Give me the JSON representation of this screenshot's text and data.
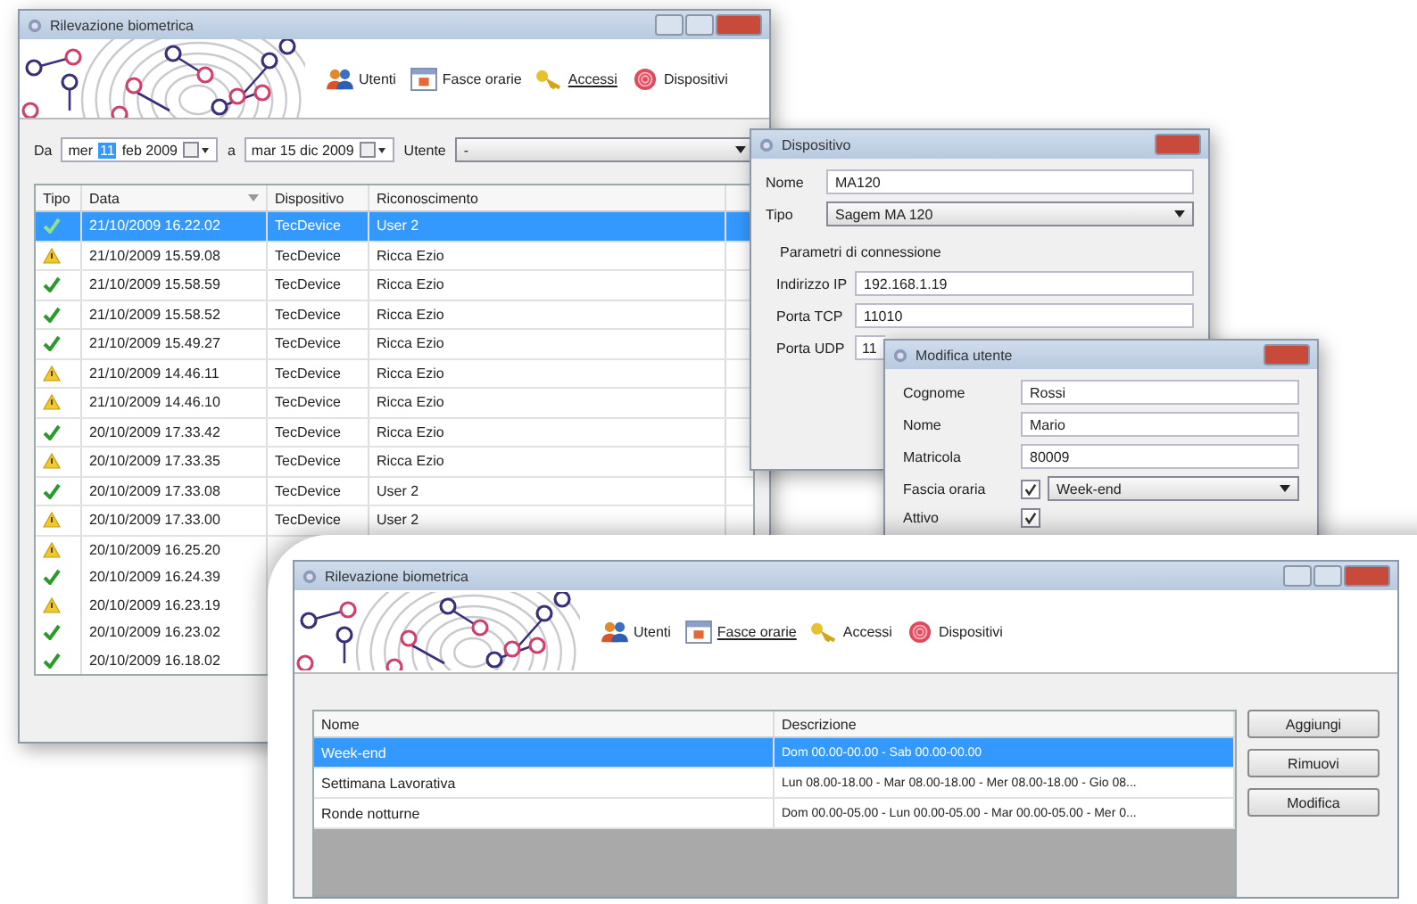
{
  "back_window": {
    "title": "Rilevazione biometrica",
    "toolbar": [
      {
        "label": "Utenti",
        "selected": false
      },
      {
        "label": "Fasce orarie",
        "selected": false
      },
      {
        "label": "Accessi",
        "selected": true
      },
      {
        "label": "Dispositivi",
        "selected": false
      }
    ],
    "filter": {
      "from_label": "Da",
      "from_weekday": "mer",
      "from_day": "11",
      "from_rest": "feb 2009",
      "to_label": "a",
      "to_date": "mar 15 dic 2009",
      "user_label": "Utente",
      "user_value": "-"
    },
    "table": {
      "columns": [
        "Tipo",
        "Data",
        "Dispositivo",
        "Riconoscimento"
      ],
      "rows": [
        {
          "kind": "ok",
          "date": "21/10/2009 16.22.02",
          "device": "TecDevice",
          "recognition": "User 2",
          "selected": true
        },
        {
          "kind": "warning",
          "date": "21/10/2009 15.59.08",
          "device": "TecDevice",
          "recognition": "Ricca Ezio",
          "selected": false
        },
        {
          "kind": "ok",
          "date": "21/10/2009 15.58.59",
          "device": "TecDevice",
          "recognition": "Ricca Ezio",
          "selected": false
        },
        {
          "kind": "ok",
          "date": "21/10/2009 15.58.52",
          "device": "TecDevice",
          "recognition": "Ricca Ezio",
          "selected": false
        },
        {
          "kind": "ok",
          "date": "21/10/2009 15.49.27",
          "device": "TecDevice",
          "recognition": "Ricca Ezio",
          "selected": false
        },
        {
          "kind": "warning",
          "date": "21/10/2009 14.46.11",
          "device": "TecDevice",
          "recognition": "Ricca Ezio",
          "selected": false
        },
        {
          "kind": "warning",
          "date": "21/10/2009 14.46.10",
          "device": "TecDevice",
          "recognition": "Ricca Ezio",
          "selected": false
        },
        {
          "kind": "ok",
          "date": "20/10/2009 17.33.42",
          "device": "TecDevice",
          "recognition": "Ricca Ezio",
          "selected": false
        },
        {
          "kind": "warning",
          "date": "20/10/2009 17.33.35",
          "device": "TecDevice",
          "recognition": "Ricca Ezio",
          "selected": false
        },
        {
          "kind": "ok",
          "date": "20/10/2009 17.33.08",
          "device": "TecDevice",
          "recognition": "User 2",
          "selected": false
        },
        {
          "kind": "warning",
          "date": "20/10/2009 17.33.00",
          "device": "TecDevice",
          "recognition": "User 2",
          "selected": false
        },
        {
          "kind": "warning",
          "date": "20/10/2009 16.25.20",
          "selected": false
        },
        {
          "kind": "ok",
          "date": "20/10/2009 16.24.39",
          "selected": false
        },
        {
          "kind": "warning",
          "date": "20/10/2009 16.23.19",
          "selected": false
        },
        {
          "kind": "ok",
          "date": "20/10/2009 16.23.02",
          "selected": false
        },
        {
          "kind": "ok",
          "date": "20/10/2009 16.18.02",
          "selected": false
        }
      ]
    }
  },
  "device_dialog": {
    "title": "Dispositivo",
    "name_label": "Nome",
    "name_value": "MA120",
    "type_label": "Tipo",
    "type_value": "Sagem MA 120",
    "section": "Parametri di connessione",
    "fields": [
      {
        "label": "Indirizzo IP",
        "value": "192.168.1.19"
      },
      {
        "label": "Porta TCP",
        "value": "11010"
      },
      {
        "label": "Porta UDP",
        "value": "11"
      }
    ]
  },
  "user_dialog": {
    "title": "Modifica utente",
    "fields": [
      {
        "label": "Cognome",
        "value": "Rossi"
      },
      {
        "label": "Nome",
        "value": "Mario"
      },
      {
        "label": "Matricola",
        "value": "80009"
      }
    ],
    "schedule_label": "Fascia oraria",
    "schedule_checked": true,
    "schedule_value": "Week-end",
    "active_label": "Attivo",
    "active_checked": true
  },
  "front_window": {
    "title": "Rilevazione biometrica",
    "toolbar": [
      {
        "label": "Utenti",
        "selected": false
      },
      {
        "label": "Fasce orarie",
        "selected": true
      },
      {
        "label": "Accessi",
        "selected": false
      },
      {
        "label": "Dispositivi",
        "selected": false
      }
    ],
    "table": {
      "columns": [
        "Nome",
        "Descrizione"
      ],
      "rows": [
        {
          "name": "Week-end",
          "description": "Dom 00.00-00.00 - Sab 00.00-00.00",
          "selected": true
        },
        {
          "name": "Settimana Lavorativa",
          "description": "Lun 08.00-18.00 - Mar 08.00-18.00 - Mer 08.00-18.00 - Gio 08...",
          "selected": false
        },
        {
          "name": "Ronde notturne",
          "description": "Dom 00.00-05.00 - Lun 00.00-05.00 - Mar 00.00-05.00 - Mer 0...",
          "selected": false
        }
      ]
    },
    "buttons": [
      "Aggiungi",
      "Rimuovi",
      "Modifica"
    ]
  }
}
